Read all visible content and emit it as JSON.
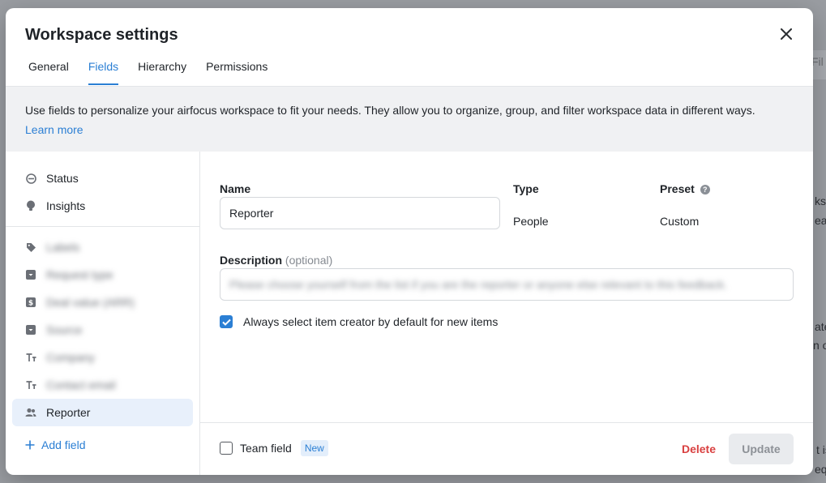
{
  "background": {
    "fragments": [
      "Fil",
      "ksp",
      "eat",
      "ate",
      "n ou",
      "t is",
      "equ"
    ]
  },
  "modal": {
    "title": "Workspace settings",
    "tabs": [
      {
        "label": "General",
        "active": false
      },
      {
        "label": "Fields",
        "active": true
      },
      {
        "label": "Hierarchy",
        "active": false
      },
      {
        "label": "Permissions",
        "active": false
      }
    ],
    "info_text": "Use fields to personalize your airfocus workspace to fit your needs. They allow you to organize, group, and filter workspace data in different ways.",
    "learn_more_label": "Learn more"
  },
  "sidebar": {
    "system_fields": [
      {
        "label": "Status",
        "icon": "status-icon"
      },
      {
        "label": "Insights",
        "icon": "bulb-icon"
      }
    ],
    "custom_fields": [
      {
        "label": "Labels",
        "icon": "tag-icon"
      },
      {
        "label": "Request type",
        "icon": "dropdown-icon"
      },
      {
        "label": "Deal value (ARR)",
        "icon": "dollar-icon"
      },
      {
        "label": "Source",
        "icon": "dropdown-icon"
      },
      {
        "label": "Company",
        "icon": "text-icon"
      },
      {
        "label": "Contact email",
        "icon": "text-icon"
      },
      {
        "label": "Reporter",
        "icon": "people-icon",
        "active": true
      }
    ],
    "add_field_label": "Add field"
  },
  "field_editor": {
    "name_label": "Name",
    "name_value": "Reporter",
    "type_label": "Type",
    "type_value": "People",
    "preset_label": "Preset",
    "preset_value": "Custom",
    "description_label": "Description",
    "description_optional": "(optional)",
    "description_value": "Please choose yourself from the list if you are the reporter or anyone else relevant to this feedback.",
    "default_creator_label": "Always select item creator by default for new items",
    "default_creator_checked": true
  },
  "footer": {
    "team_field_label": "Team field",
    "team_field_checked": false,
    "new_badge": "New",
    "delete_label": "Delete",
    "update_label": "Update"
  },
  "colors": {
    "accent": "#2b7fd4",
    "danger": "#d94040",
    "overlay": "#8a8d92"
  }
}
